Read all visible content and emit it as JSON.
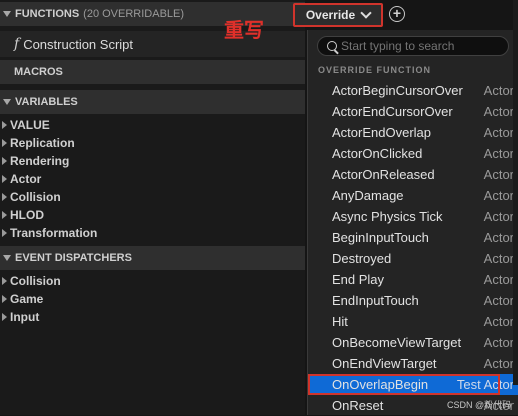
{
  "functions": {
    "title": "FUNCTIONS",
    "count": "(20 OVERRIDABLE)",
    "construction": "Construction Script"
  },
  "macros": {
    "title": "MACROS"
  },
  "variables": {
    "title": "VARIABLES",
    "items": [
      "VALUE",
      "Replication",
      "Rendering",
      "Actor",
      "Collision",
      "HLOD",
      "Transformation"
    ]
  },
  "event_dispatchers": {
    "title": "EVENT DISPATCHERS",
    "items": [
      "Collision",
      "Game",
      "Input"
    ]
  },
  "annotation": "重写",
  "toolbar": {
    "override_label": "Override",
    "add_label": "+"
  },
  "dropdown": {
    "search_placeholder": "Start typing to search",
    "section_label": "OVERRIDE FUNCTION",
    "items": [
      {
        "name": "ActorBeginCursorOver",
        "category": "Actor"
      },
      {
        "name": "ActorEndCursorOver",
        "category": "Actor"
      },
      {
        "name": "ActorEndOverlap",
        "category": "Actor"
      },
      {
        "name": "ActorOnClicked",
        "category": "Actor"
      },
      {
        "name": "ActorOnReleased",
        "category": "Actor"
      },
      {
        "name": "AnyDamage",
        "category": "Actor"
      },
      {
        "name": "Async Physics Tick",
        "category": "Actor"
      },
      {
        "name": "BeginInputTouch",
        "category": "Actor"
      },
      {
        "name": "Destroyed",
        "category": "Actor"
      },
      {
        "name": "End Play",
        "category": "Actor"
      },
      {
        "name": "EndInputTouch",
        "category": "Actor"
      },
      {
        "name": "Hit",
        "category": "Actor"
      },
      {
        "name": "OnBecomeViewTarget",
        "category": "Actor"
      },
      {
        "name": "OnEndViewTarget",
        "category": "Actor"
      },
      {
        "name": "OnOverlapBegin",
        "category": "Test Actor"
      },
      {
        "name": "OnReset",
        "category": "Actor"
      }
    ],
    "selected_index": 14
  },
  "watermark": "CSDN @粉代码",
  "colors": {
    "accent_selected": "#0f6ad6",
    "highlight_red": "#d0342c"
  }
}
